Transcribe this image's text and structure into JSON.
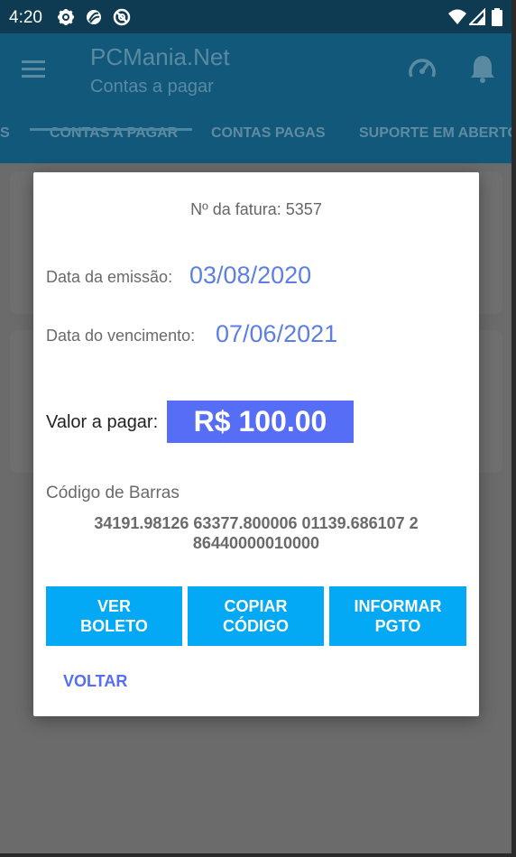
{
  "status_bar": {
    "time": "4:20",
    "left_icons": [
      "settings-icon",
      "sync-icon",
      "no-disturb-icon"
    ],
    "right_icons": [
      "wifi-icon",
      "signal-icon",
      "battery-icon"
    ]
  },
  "app_bar": {
    "title": "PCMania.Net",
    "subtitle": "Contas a pagar",
    "icons": [
      "menu-icon",
      "speedometer-icon",
      "bell-icon"
    ]
  },
  "tabs": [
    {
      "label": "S",
      "active": false
    },
    {
      "label": "CONTAS A PAGAR",
      "active": true
    },
    {
      "label": "CONTAS PAGAS",
      "active": false
    },
    {
      "label": "SUPORTE EM ABERTO",
      "active": false
    }
  ],
  "dialog": {
    "invoice": "Nº da fatura: 5357",
    "issue_label": "Data da emissão:",
    "issue_date": "03/08/2020",
    "due_label": "Data do vencimento:",
    "due_date": "07/06/2021",
    "amount_label": "Valor a pagar:",
    "amount": "R$ 100.00",
    "barcode_label": "Código de Barras",
    "barcode": "34191.98126 63377.800006 01139.686107 2 86440000010000",
    "buttons": {
      "view": "VER BOLETO",
      "copy": "COPIAR CÓDIGO",
      "inform": "INFORMAR PGTO"
    },
    "back": "VOLTAR"
  },
  "colors": {
    "status_bar": "#0e3b52",
    "app_bar": "#12587b",
    "accent_blue": "#566df6",
    "button_blue": "#03a9f4",
    "date_blue": "#5b7fe6"
  }
}
